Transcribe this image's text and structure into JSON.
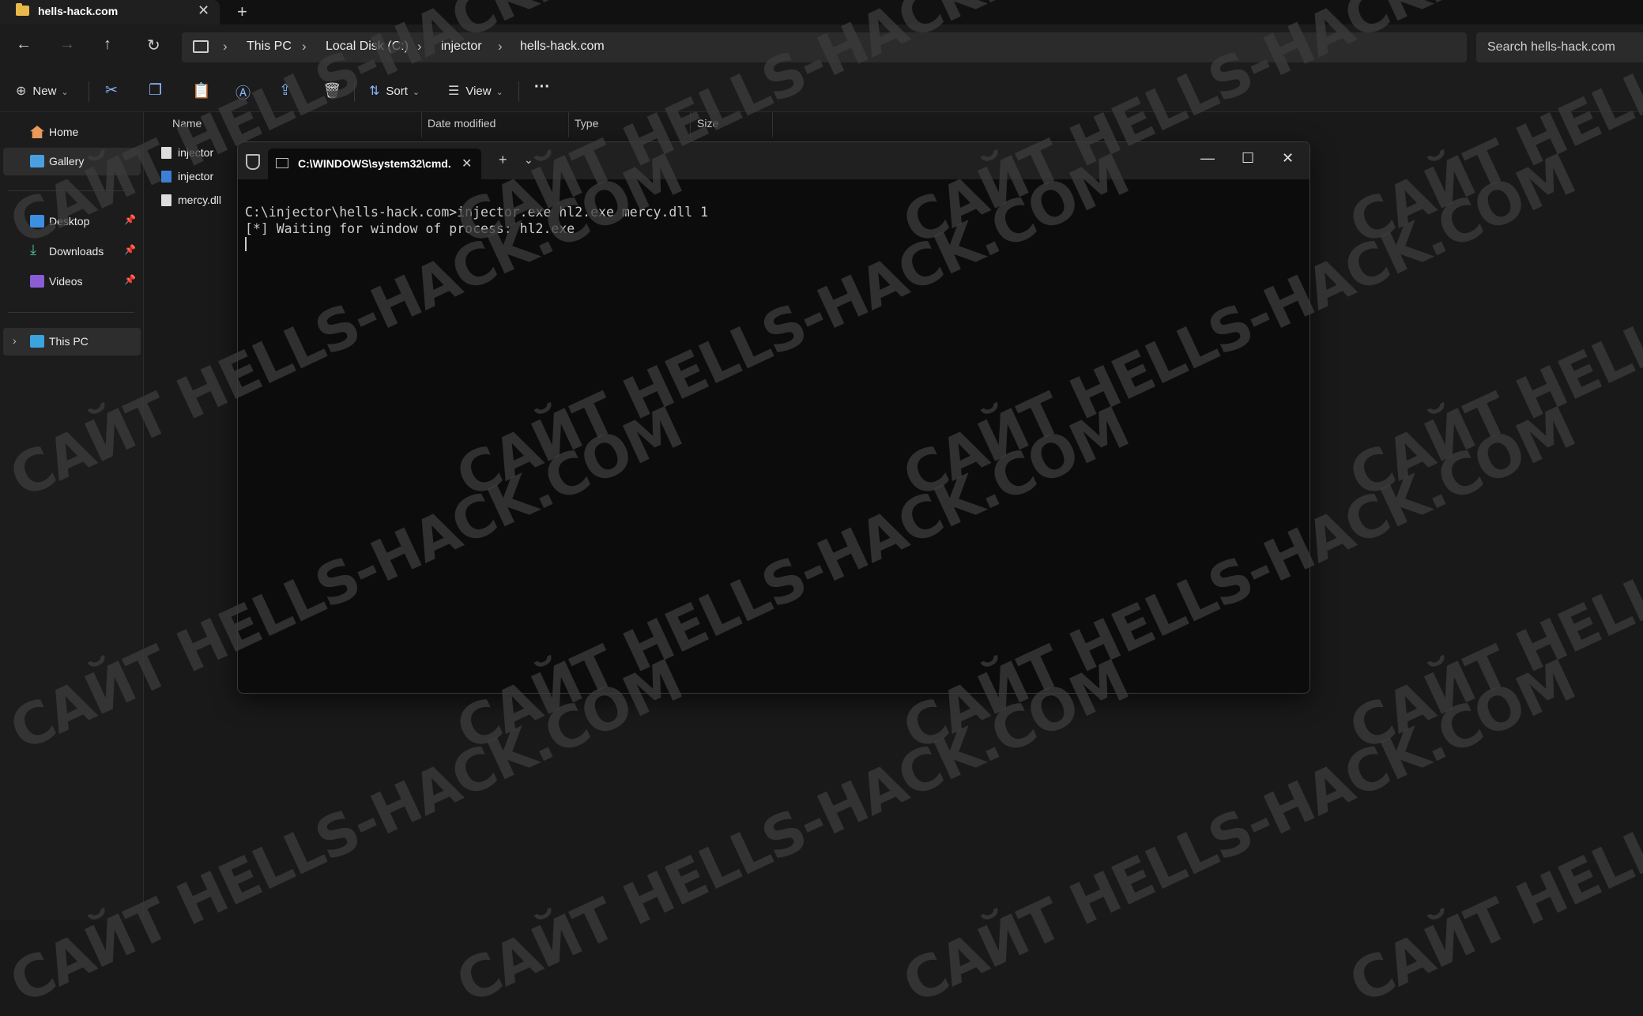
{
  "tab": {
    "title": "hells-hack.com",
    "close": "✕",
    "new": "+"
  },
  "nav": {
    "back": "←",
    "forward": "→",
    "up": "↑",
    "refresh": "↻"
  },
  "breadcrumb": [
    "This PC",
    "Local Disk (C:)",
    "injector",
    "hells-hack.com"
  ],
  "breadcrumb_sep": "›",
  "search": {
    "placeholder": "Search hells-hack.com"
  },
  "commandbar": {
    "new_label": "New",
    "sort_label": "Sort",
    "view_label": "View",
    "more": "···"
  },
  "sidebar": {
    "items": [
      {
        "label": "Home"
      },
      {
        "label": "Gallery"
      },
      {
        "label": "Desktop"
      },
      {
        "label": "Downloads"
      },
      {
        "label": "Videos"
      },
      {
        "label": "This PC"
      }
    ]
  },
  "columns": [
    "Name",
    "Date modified",
    "Type",
    "Size"
  ],
  "files": [
    {
      "name": "injector"
    },
    {
      "name": "injector"
    },
    {
      "name": "mercy.dll"
    }
  ],
  "terminal": {
    "tab_title": "C:\\WINDOWS\\system32\\cmd.",
    "line1": "C:\\injector\\hells-hack.com>injector.exe hl2.exe mercy.dll 1",
    "line2": "[*] Waiting for window of process: hl2.exe"
  },
  "watermark": "САЙТ HELLS-HACK.COM"
}
